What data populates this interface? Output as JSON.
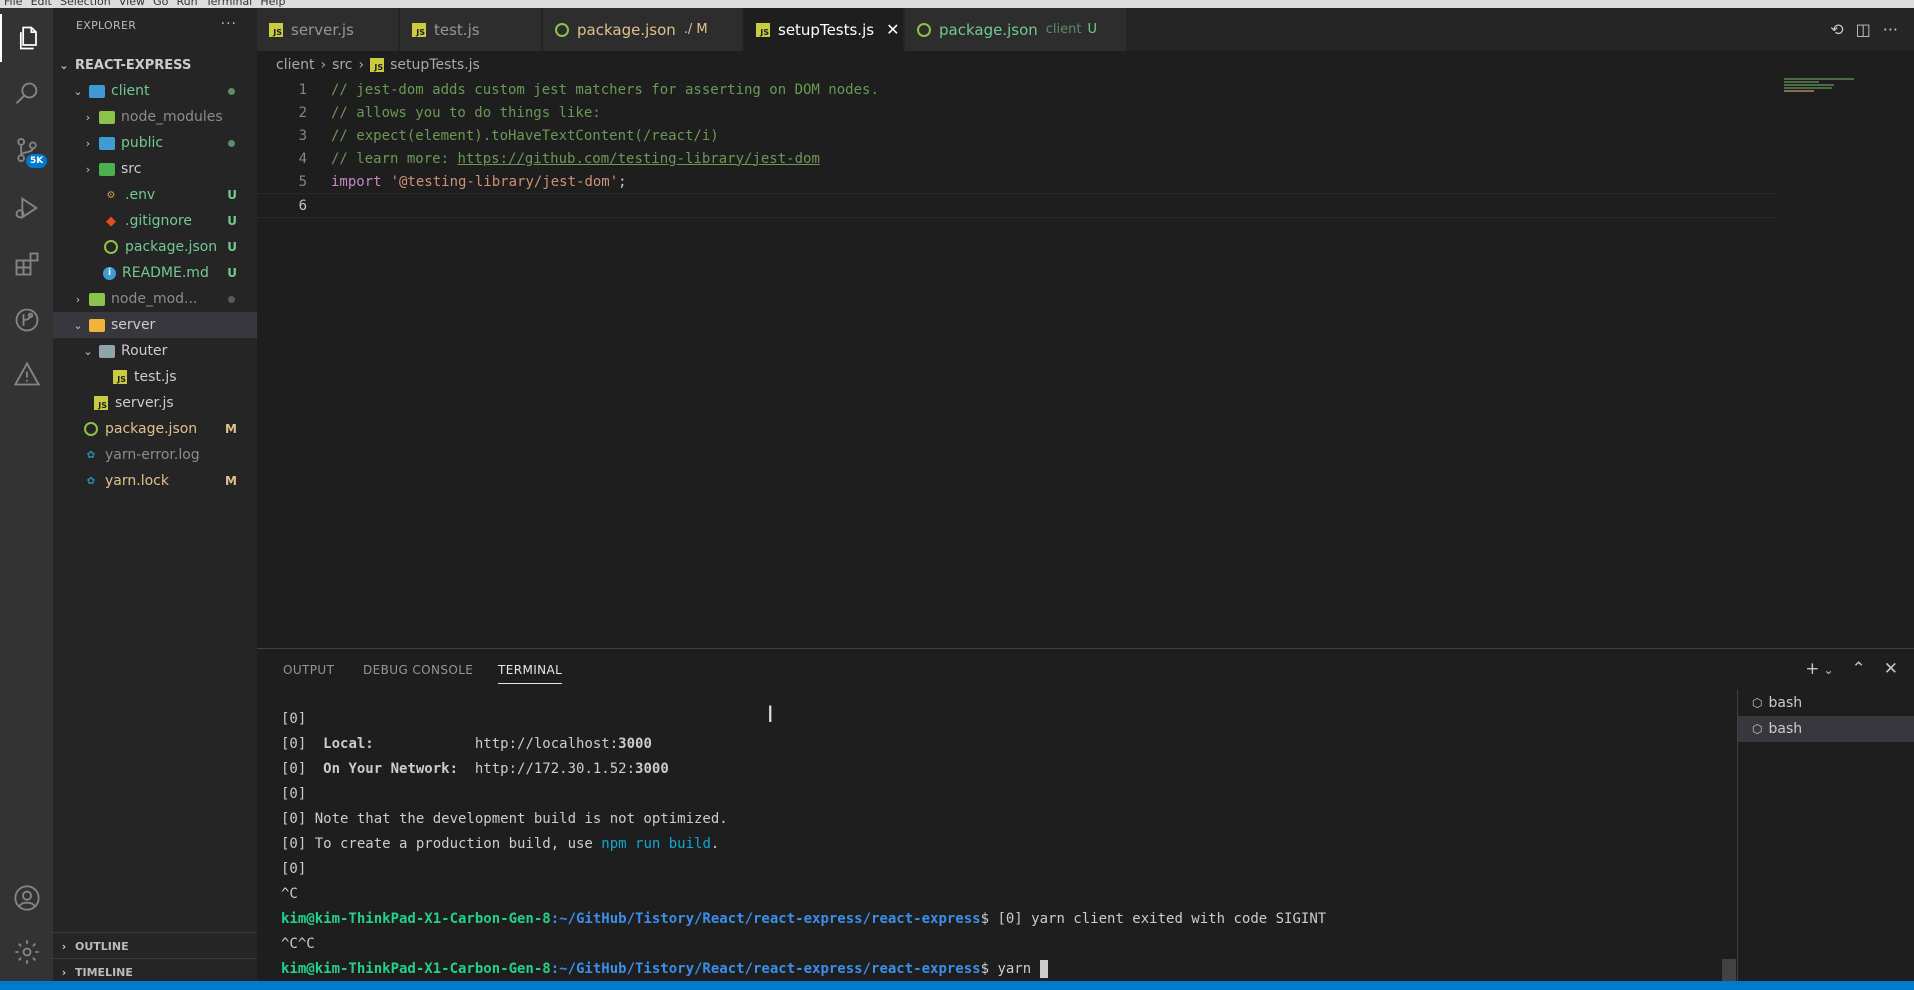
{
  "menubar": {
    "items": [
      "File",
      "Edit",
      "Selection",
      "View",
      "Go",
      "Run",
      "Terminal",
      "Help"
    ]
  },
  "activity": {
    "scm_badge": "5K"
  },
  "explorer": {
    "title": "EXPLORER",
    "more": "···",
    "root": "REACT-EXPRESS",
    "items": [
      {
        "label": "client"
      },
      {
        "label": "node_modules"
      },
      {
        "label": "public"
      },
      {
        "label": "src"
      },
      {
        "label": ".env",
        "status": "U"
      },
      {
        "label": ".gitignore",
        "status": "U"
      },
      {
        "label": "package.json",
        "status": "U"
      },
      {
        "label": "README.md",
        "status": "U"
      },
      {
        "label": "node_mod..."
      },
      {
        "label": "server"
      },
      {
        "label": "Router"
      },
      {
        "label": "test.js"
      },
      {
        "label": "server.js"
      },
      {
        "label": "package.json",
        "status": "M"
      },
      {
        "label": "yarn-error.log"
      },
      {
        "label": "yarn.lock",
        "status": "M"
      }
    ],
    "outline": "OUTLINE",
    "timeline": "TIMELINE"
  },
  "tabs": [
    {
      "label": "server.js",
      "suffix": ""
    },
    {
      "label": "test.js",
      "suffix": ""
    },
    {
      "label": "package.json",
      "suffix": "./ M"
    },
    {
      "label": "setupTests.js",
      "suffix": "",
      "close": "✕"
    },
    {
      "label": "package.json",
      "suffix": "client",
      "status": "U"
    }
  ],
  "breadcrumb": {
    "parts": [
      "client",
      "src",
      "setupTests.js"
    ]
  },
  "editor": {
    "lines": [
      {
        "n": "1",
        "text": "// jest-dom adds custom jest matchers for asserting on DOM nodes."
      },
      {
        "n": "2",
        "text": "// allows you to do things like:"
      },
      {
        "n": "3",
        "text": "// expect(element).toHaveTextContent(/react/i)"
      },
      {
        "n": "4",
        "prefix": "// learn more: ",
        "link": "https://github.com/testing-library/jest-dom"
      },
      {
        "n": "5",
        "kw": "import",
        "str": "'@testing-library/jest-dom'",
        "end": ";"
      },
      {
        "n": "6",
        "text": ""
      }
    ]
  },
  "panel": {
    "tabs": [
      "OUTPUT",
      "DEBUG CONSOLE",
      "TERMINAL"
    ],
    "terminals": [
      "bash",
      "bash"
    ],
    "lines": {
      "l1": "[0]",
      "l2_pre": "[0]  ",
      "l2_label": "Local:",
      "l2_mid": "            http://localhost:",
      "l2_port": "3000",
      "l3_pre": "[0]  ",
      "l3_label": "On Your Network:",
      "l3_mid": "  http://172.30.1.52:",
      "l3_port": "3000",
      "l4": "[0]",
      "l5": "[0] Note that the development build is not optimized.",
      "l6_pre": "[0] To create a production build, use ",
      "l6_cmd": "npm run build",
      "l6_end": ".",
      "l7": "[0]",
      "l8": "^C",
      "user": "kim@kim-ThinkPad-X1-Carbon-Gen-8",
      "path": ":~/GitHub/Tistory/React/react-express/react-express",
      "l9_rest": "$ [0] yarn client exited with code SIGINT",
      "l10": "^C^C",
      "l11_rest": "$ yarn "
    }
  },
  "colors": {
    "accent": "#007acc",
    "untracked": "#73c991",
    "modified": "#e2c08d",
    "comment": "#6a9955"
  }
}
